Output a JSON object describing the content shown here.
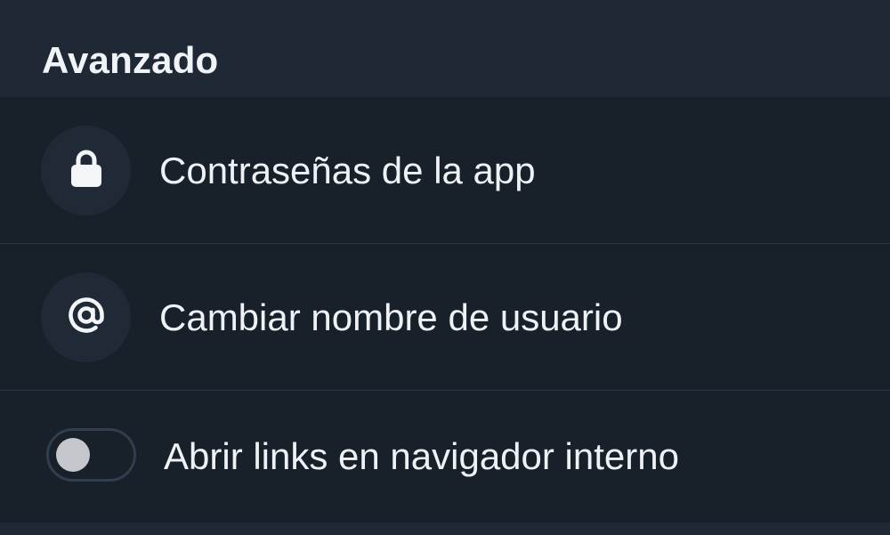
{
  "section": {
    "title": "Avanzado"
  },
  "items": [
    {
      "label": "Contraseñas de la app",
      "icon": "lock-icon"
    },
    {
      "label": "Cambiar nombre de usuario",
      "icon": "at-sign-icon"
    },
    {
      "label": "Abrir links en navigador interno",
      "toggle_on": false
    }
  ],
  "colors": {
    "header_bg": "#1e2935",
    "list_bg": "#18202a",
    "icon_bg": "#1f2a36",
    "text": "#eef2f5",
    "toggle_border": "#2f3f51",
    "toggle_knob": "#c6c7cd"
  }
}
